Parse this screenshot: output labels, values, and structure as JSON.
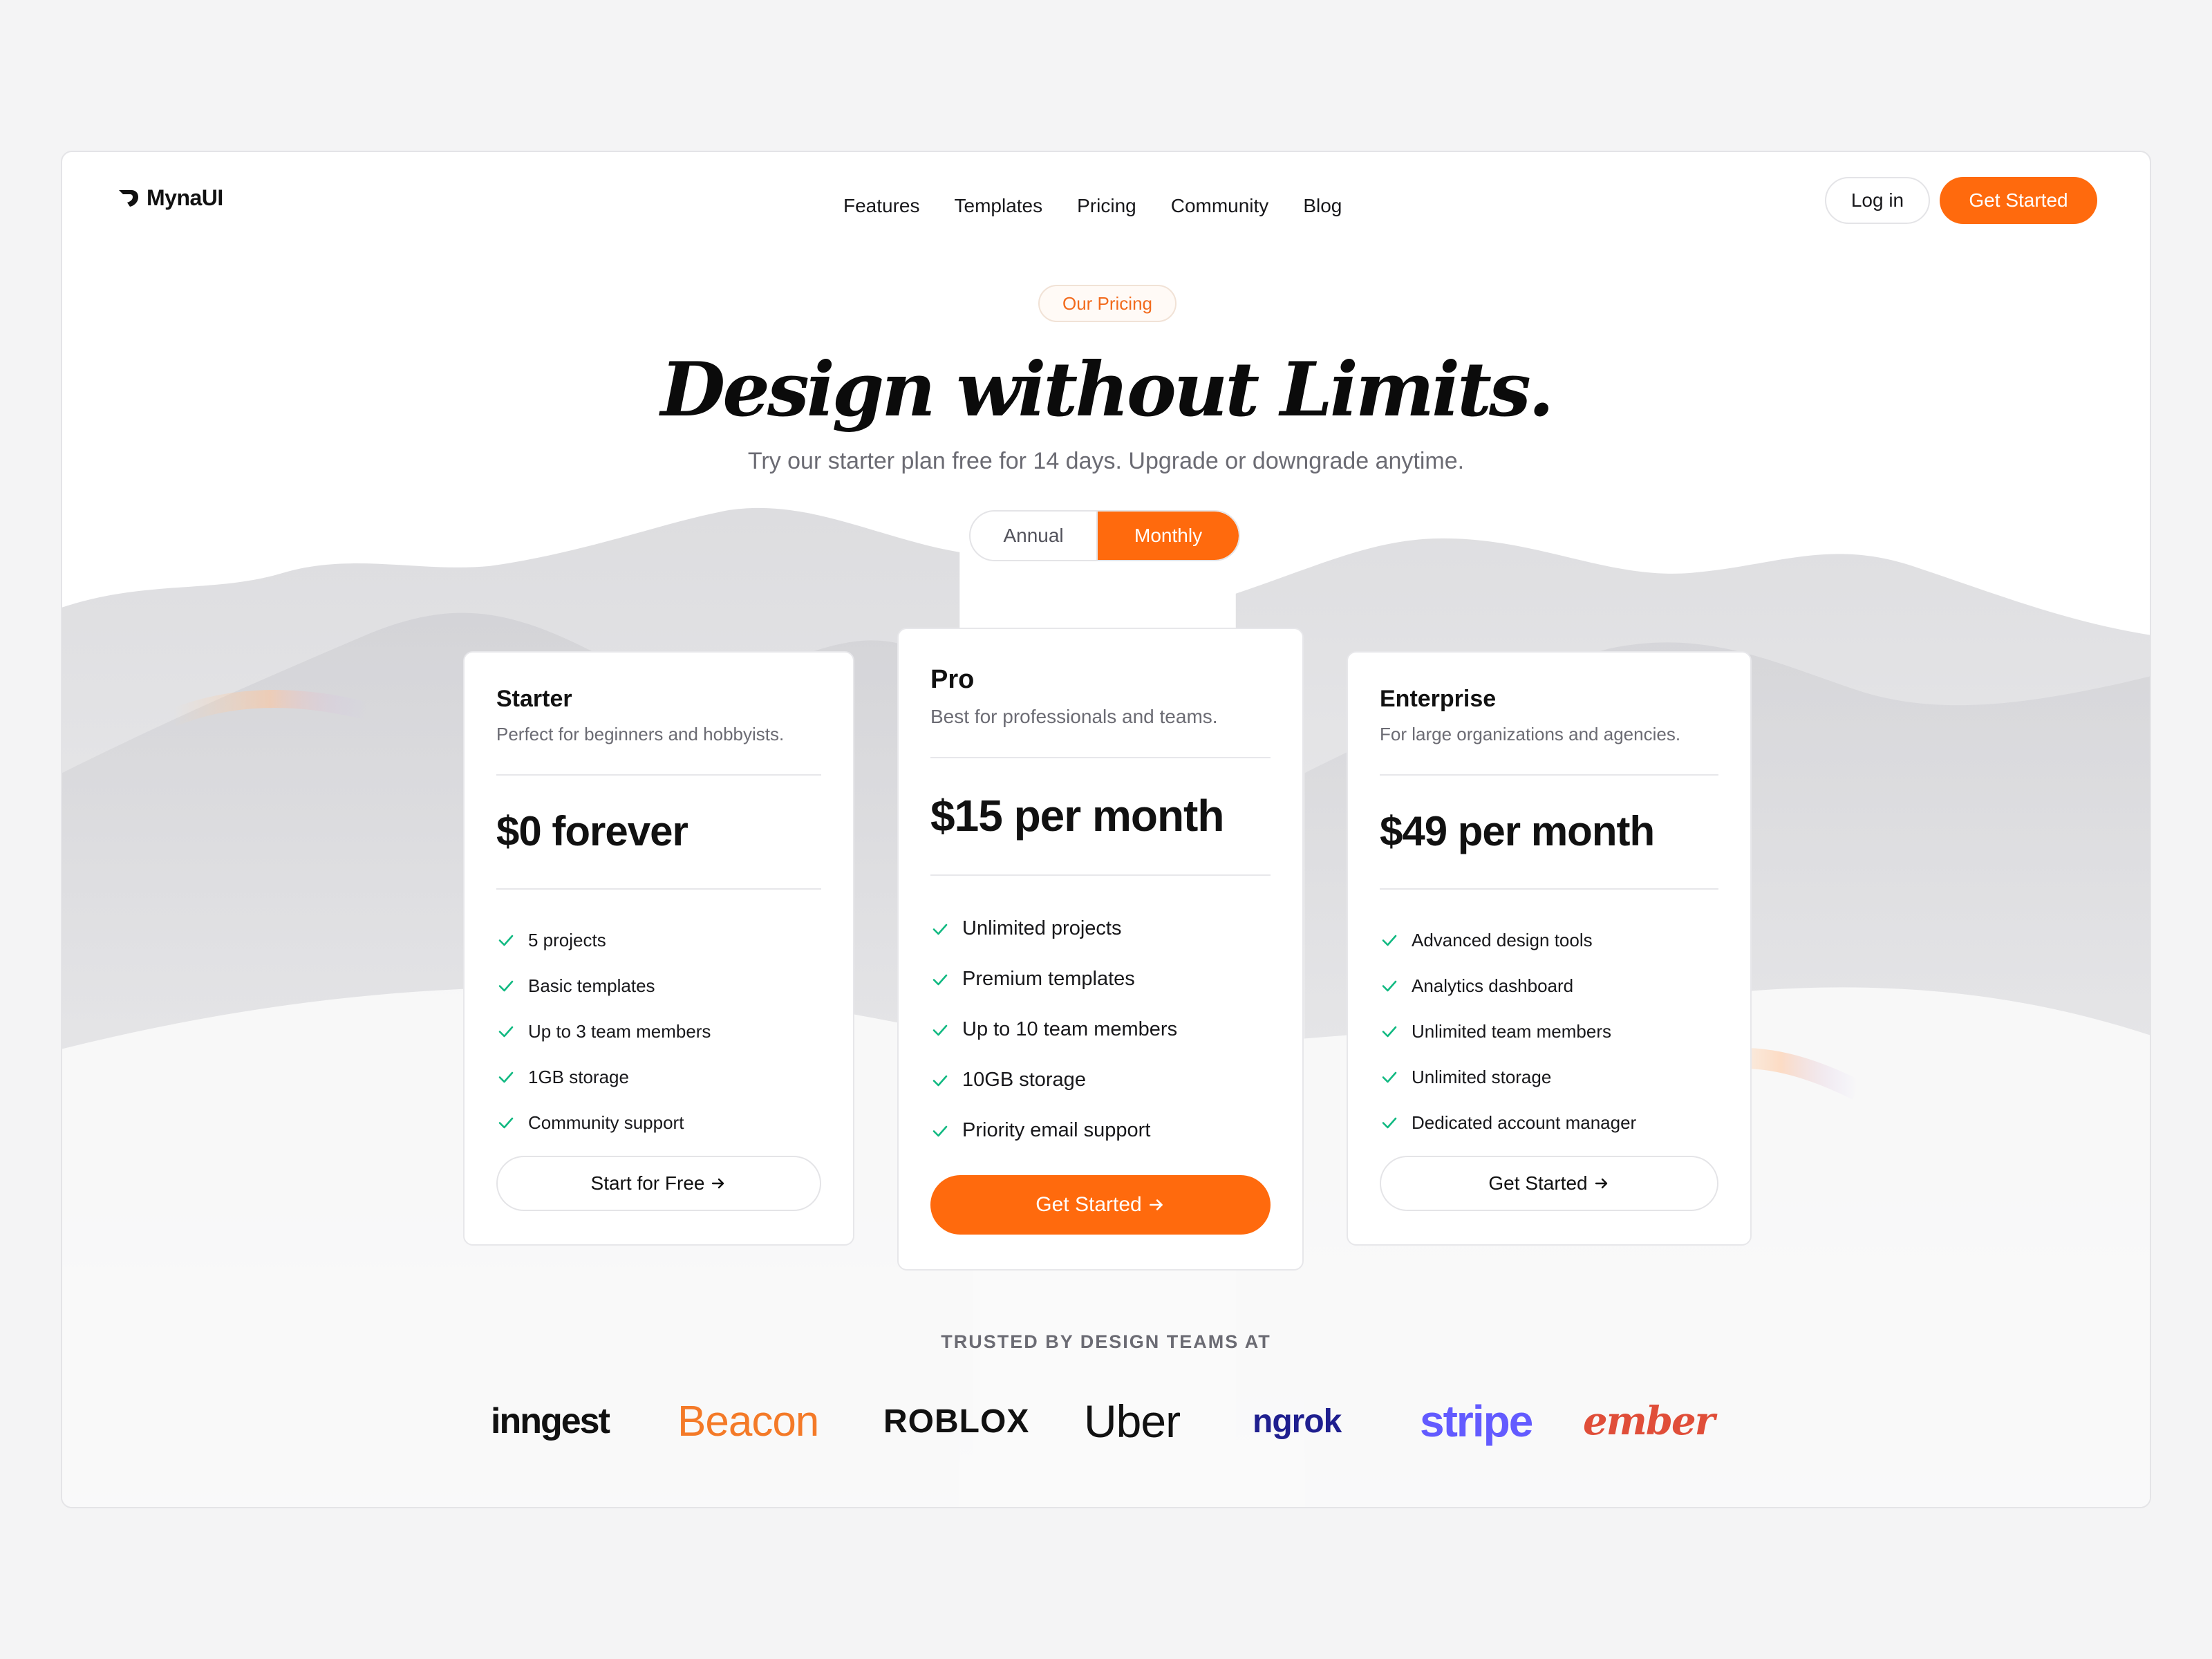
{
  "brand": {
    "name": "MynaUI"
  },
  "nav": {
    "links": [
      "Features",
      "Templates",
      "Pricing",
      "Community",
      "Blog"
    ],
    "login_label": "Log in",
    "cta_label": "Get Started"
  },
  "hero": {
    "eyebrow": "Our Pricing",
    "title": "Design without Limits.",
    "subtitle": "Try our starter plan free for 14 days. Upgrade or downgrade anytime.",
    "billing_toggle": {
      "options": [
        "Annual",
        "Monthly"
      ],
      "selected": "Monthly"
    }
  },
  "plans": [
    {
      "name": "Starter",
      "description": "Perfect for beginners and hobbyists.",
      "price": "$0 forever",
      "features": [
        "5 projects",
        "Basic templates",
        "Up to 3 team members",
        "1GB storage",
        "Community support"
      ],
      "button_label": "Start for Free"
    },
    {
      "name": "Pro",
      "description": "Best for professionals and teams.",
      "price": "$15 per month",
      "features": [
        "Unlimited projects",
        "Premium templates",
        "Up to 10 team members",
        "10GB storage",
        "Priority email support"
      ],
      "button_label": "Get Started"
    },
    {
      "name": "Enterprise",
      "description": "For large organizations and agencies.",
      "price": "$49 per month",
      "features": [
        "Advanced design tools",
        "Analytics dashboard",
        "Unlimited team members",
        "Unlimited storage",
        "Dedicated account manager"
      ],
      "button_label": "Get Started"
    }
  ],
  "trusted": {
    "heading": "TRUSTED BY DESIGN TEAMS AT",
    "logos": [
      "inngest",
      "Beacon",
      "ROBLOX",
      "Uber",
      "ngrok",
      "stripe",
      "ember"
    ]
  },
  "colors": {
    "accent": "#ff6a0d",
    "check": "#10b981",
    "text_muted": "#6b6b73"
  },
  "icons": {
    "check": "check-icon",
    "arrow": "arrow-right-icon",
    "logo": "mynaui-logo-icon"
  }
}
